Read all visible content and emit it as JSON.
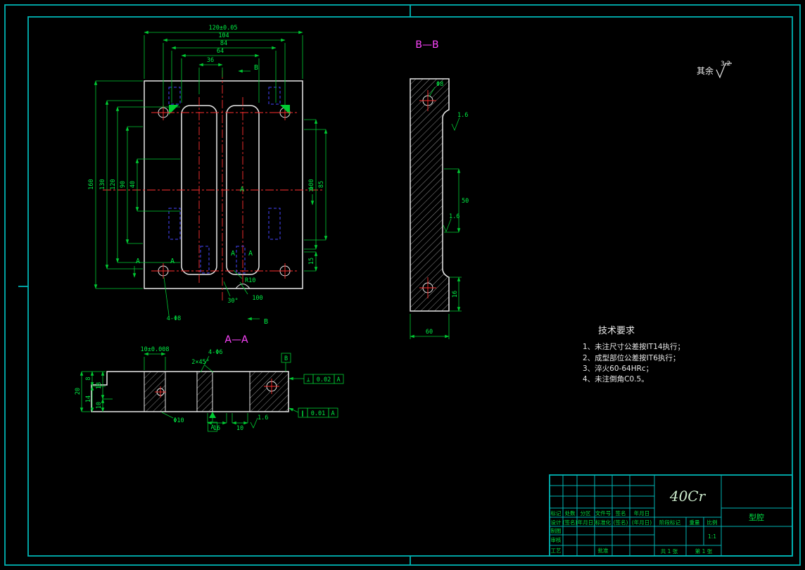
{
  "drawing": {
    "surface_note": {
      "prefix": "其余",
      "value": "3.2"
    },
    "tech": {
      "title": "技术要求",
      "items": [
        "1、未注尺寸公差按IT14执行；",
        "2、成型部位公差按IT6执行；",
        "3、淬火60-64HRc；",
        "4、未注倒角C0.5。"
      ]
    },
    "main_view": {
      "top_dims": [
        "120±0.05",
        "104",
        "84",
        "64",
        "36"
      ],
      "left_dims": [
        "160",
        "130",
        "120",
        "90",
        "40"
      ],
      "right_dims": [
        "100",
        "85",
        "15"
      ],
      "radius_label": "R10",
      "angle_label": "30°",
      "slant_label": "100",
      "hole_callout": "4-Φ8",
      "b_label": "B",
      "a_label": "A"
    },
    "bb_view": {
      "title": "B—B",
      "hole_note": "Φ8",
      "dim_mid": "50",
      "dim_width": "60",
      "dim_bottom": "16",
      "rough1": "1.6",
      "rough2": "1.6"
    },
    "aa_view": {
      "title": "A—A",
      "fit_dim": "10±0.008",
      "holes_note": "4-Φ6",
      "chamfer_note": "2×45°",
      "left_dims": [
        "20",
        "8",
        "14",
        "18",
        "10"
      ],
      "dia_note": "Φ10",
      "dim_16": "16",
      "dim_10": "10",
      "rough": "1.6",
      "fcf1": {
        "sym": "⊥",
        "tol": "0.02",
        "datum": "A"
      },
      "fcf2": {
        "sym": "∥",
        "tol": "0.01",
        "datum": "A"
      },
      "datum_b": "B",
      "datum_a": "A"
    }
  },
  "title_block": {
    "material": "40Cr",
    "part_name": "型腔",
    "header_row": [
      "标记",
      "处数",
      "分区",
      "文件号",
      "签名",
      "年月日"
    ],
    "design_row": [
      "设计",
      "(签名)",
      "(年月日)",
      "标准化",
      "(签名)",
      "(年月日)"
    ],
    "row_draw": "制图",
    "row_check": "审核",
    "row_process": "工艺",
    "row_approve": "批准",
    "stage_label": "阶段标记",
    "weight_label": "重量",
    "scale_label": "比例",
    "scale_value": "1:1",
    "sheet_total": "共 1 张",
    "sheet_no": "第 1 张"
  }
}
